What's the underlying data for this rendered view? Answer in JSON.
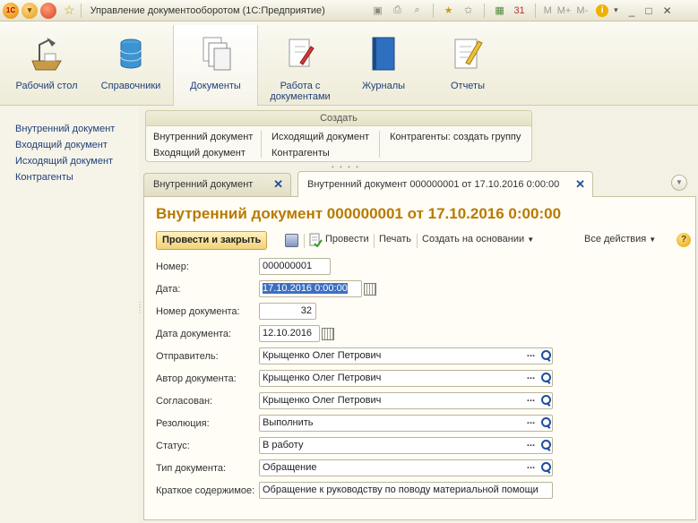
{
  "window": {
    "title": "Управление документооборотом (1С:Предприятие)",
    "m_buttons": [
      "M",
      "M+",
      "M-"
    ]
  },
  "sections": [
    {
      "label": "Рабочий стол",
      "icon": "desk-lamp-icon"
    },
    {
      "label": "Справочники",
      "icon": "database-icon"
    },
    {
      "label": "Документы",
      "icon": "documents-icon"
    },
    {
      "label": "Работа с документами",
      "icon": "document-pen-icon"
    },
    {
      "label": "Журналы",
      "icon": "journal-book-icon"
    },
    {
      "label": "Отчеты",
      "icon": "report-pencil-icon"
    }
  ],
  "leftnav": [
    "Внутренний документ",
    "Входящий документ",
    "Исходящий документ",
    "Контрагенты"
  ],
  "create": {
    "title": "Создать",
    "items": [
      "Внутренний документ",
      "Входящий документ",
      "Исходящий документ",
      "Контрагенты",
      "Контрагенты: создать группу"
    ]
  },
  "tabs": [
    "Внутренний документ",
    "Внутренний документ 000000001 от 17.10.2016 0:00:00"
  ],
  "form": {
    "title": "Внутренний документ 000000001 от 17.10.2016 0:00:00",
    "commands": {
      "post_close": "Провести и закрыть",
      "post": "Провести",
      "print": "Печать",
      "create_based": "Создать на основании",
      "all_actions": "Все действия"
    },
    "fields": {
      "number": {
        "label": "Номер:",
        "value": "000000001"
      },
      "date": {
        "label": "Дата:",
        "value": "17.10.2016  0:00:00"
      },
      "doc_number": {
        "label": "Номер документа:",
        "value": "32"
      },
      "doc_date": {
        "label": "Дата документа:",
        "value": "12.10.2016"
      },
      "sender": {
        "label": "Отправитель:",
        "value": "Крыщенко Олег Петрович"
      },
      "author": {
        "label": "Автор документа:",
        "value": "Крыщенко Олег Петрович"
      },
      "approved": {
        "label": "Согласован:",
        "value": "Крыщенко Олег Петрович"
      },
      "resolution": {
        "label": "Резолюция:",
        "value": "Выполнить"
      },
      "status": {
        "label": "Статус:",
        "value": "В работу"
      },
      "doc_type": {
        "label": "Тип документа:",
        "value": "Обращение"
      },
      "summary": {
        "label": "Краткое содержимое:",
        "value": "Обращение к руководству по поводу материальной помощи"
      }
    }
  },
  "colors": {
    "accent_title": "#b87a00",
    "link": "#1f3f7a",
    "selection": "#3d6fc1",
    "primary_button": "#f2d27a"
  }
}
